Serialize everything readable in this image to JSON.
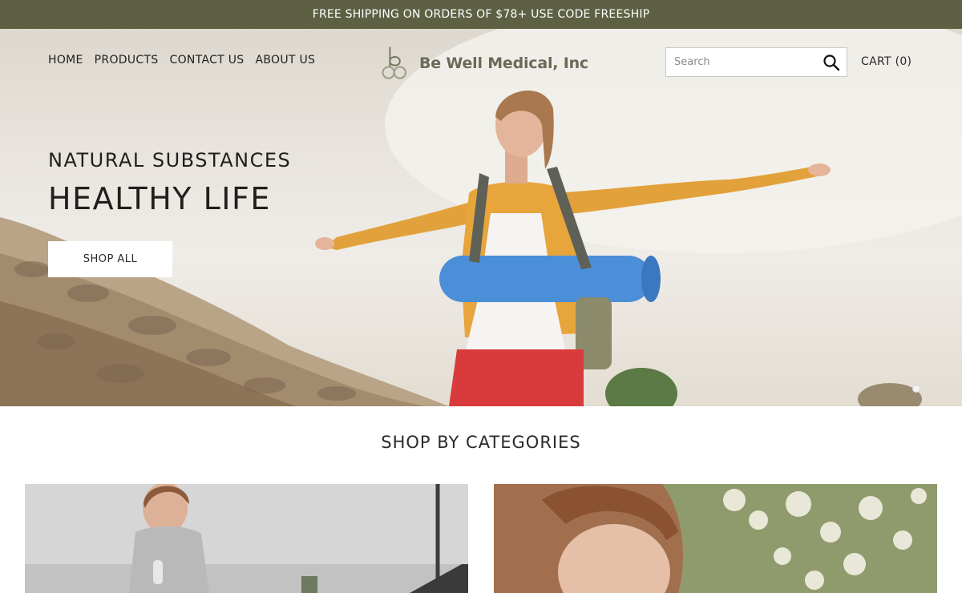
{
  "promo": {
    "text": "FREE SHIPPING ON ORDERS OF $78+ USE CODE FREESHIP"
  },
  "nav": {
    "items": [
      {
        "label": "HOME"
      },
      {
        "label": "PRODUCTS"
      },
      {
        "label": "CONTACT US"
      },
      {
        "label": "ABOUT US"
      }
    ]
  },
  "brand": {
    "name": "Be Well Medical, Inc"
  },
  "search": {
    "placeholder": "Search",
    "value": "",
    "icon": "search-icon"
  },
  "cart": {
    "label": "CART (0)"
  },
  "hero": {
    "eyebrow": "NATURAL SUBSTANCES",
    "title": "HEALTHY LIFE",
    "cta_label": "SHOP ALL",
    "active_slide": 1,
    "slide_count": 1
  },
  "categories": {
    "title": "SHOP BY CATEGORIES"
  },
  "colors": {
    "promo_bg": "#5d6043",
    "accent_text": "#1f1f1f",
    "logo_gray": "#6a6a58"
  }
}
